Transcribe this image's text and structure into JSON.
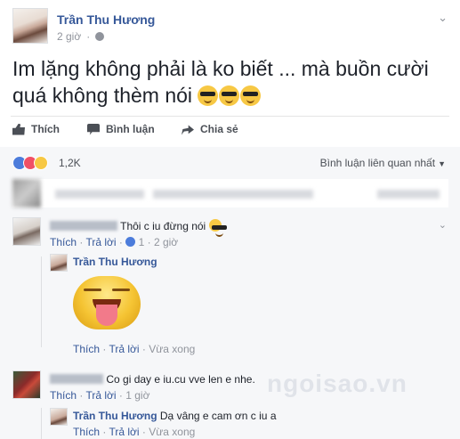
{
  "post": {
    "author": "Trần Thu Hương",
    "time": "2 giờ",
    "text": "Im lặng không phải là ko biết ... mà buồn cười quá không thèm nói",
    "emoji_count": 3
  },
  "actions": {
    "like": "Thích",
    "comment": "Bình luận",
    "share": "Chia sẻ"
  },
  "reactions": {
    "icons": [
      "like-icon",
      "love-icon",
      "haha-icon"
    ],
    "count": "1,2K",
    "sort_label": "Bình luận liên quan nhất"
  },
  "comments": [
    {
      "text": "Thôi c iu đừng nói",
      "like": "Thích",
      "reply": "Trả lời",
      "likes": "1",
      "time": "2 giờ",
      "reply_comment": {
        "author": "Trần Thu Hương",
        "like": "Thích",
        "reply": "Trả lời",
        "time": "Vừa xong"
      }
    },
    {
      "text": "Co gi day e iu.cu vve len e nhe.",
      "like": "Thích",
      "reply": "Trả lời",
      "time": "1 giờ",
      "reply_comment": {
        "author": "Trần Thu Hương",
        "text": "Dạ vâng e cam ơn c iu a",
        "like": "Thích",
        "reply": "Trả lời",
        "time": "Vừa xong"
      }
    }
  ],
  "watermark": "ngoisao.vn",
  "colors": {
    "link": "#365899",
    "meta": "#90949c",
    "comments_bg": "#f6f7f9",
    "like_blue": "#4c7cdb"
  }
}
